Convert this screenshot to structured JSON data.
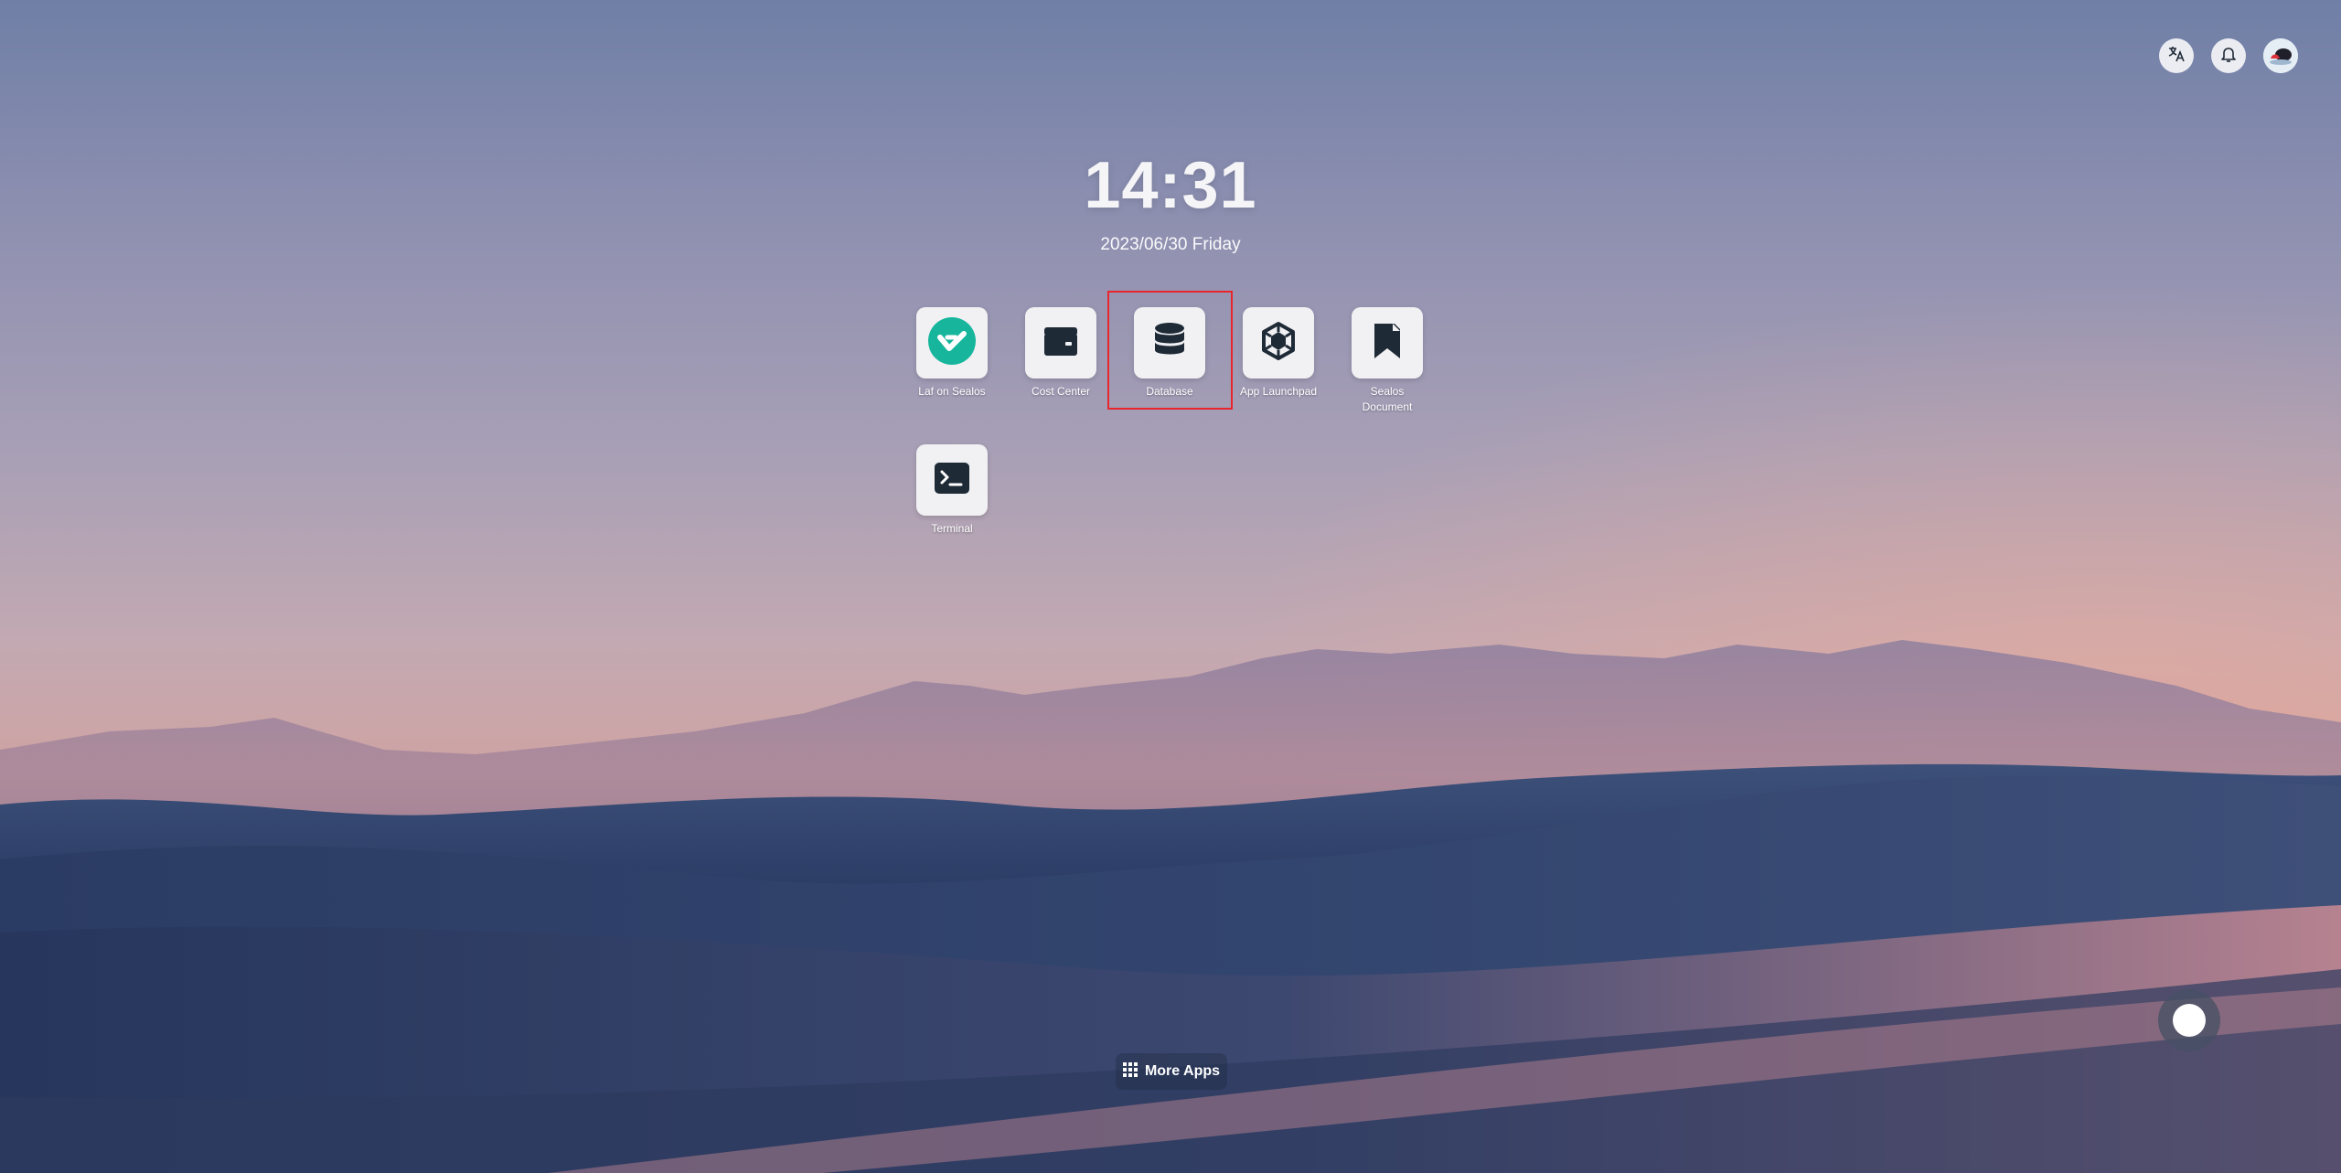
{
  "clock": {
    "time": "14:31",
    "date": "2023/06/30 Friday"
  },
  "apps": [
    {
      "label": "Laf on Sealos",
      "icon": "laf-icon"
    },
    {
      "label": "Cost Center",
      "icon": "wallet-icon"
    },
    {
      "label": "Database",
      "icon": "database-icon"
    },
    {
      "label": "App Launchpad",
      "icon": "launchpad-icon"
    },
    {
      "label": "Sealos Document",
      "icon": "bookmark-icon"
    },
    {
      "label": "Terminal",
      "icon": "terminal-icon"
    }
  ],
  "top_bar": {
    "language_icon": "translate-icon",
    "notification_icon": "bell-icon",
    "avatar_icon": "avatar"
  },
  "more_apps": {
    "label": "More Apps",
    "icon": "grid-icon"
  },
  "colors": {
    "selection": "#e8262c",
    "laf_brand": "#17b69c",
    "icon_dark": "#1f2a37"
  }
}
